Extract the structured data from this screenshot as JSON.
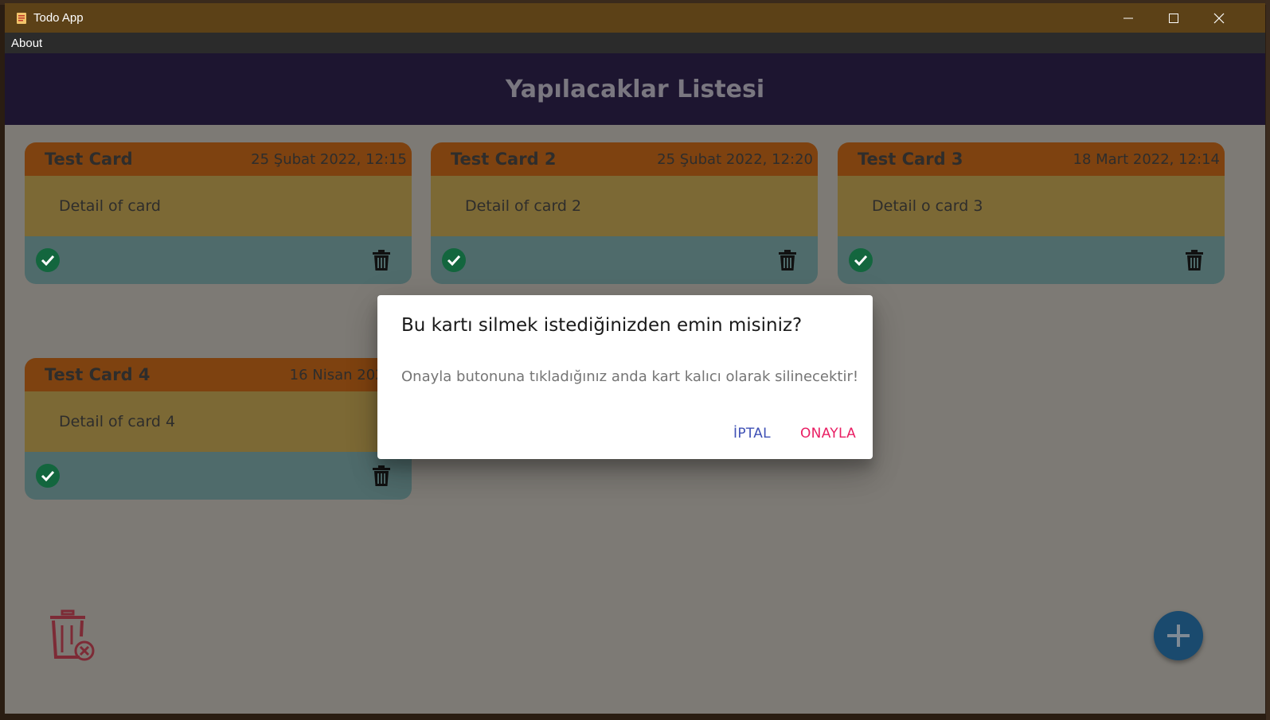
{
  "window": {
    "title": "Todo App",
    "menu": [
      "About"
    ]
  },
  "header": {
    "title": "Yapılacaklar Listesi"
  },
  "cards": [
    {
      "title": "Test Card",
      "date": "25 Şubat 2022, 12:15",
      "detail": "Detail of card"
    },
    {
      "title": "Test Card 2",
      "date": "25 Şubat 2022, 12:20",
      "detail": "Detail of card 2"
    },
    {
      "title": "Test Card 3",
      "date": "18 Mart 2022, 12:14",
      "detail": "Detail o card 3"
    },
    {
      "title": "Test Card 4",
      "date": "16 Nisan 2022, 0",
      "detail": "Detail of card 4"
    }
  ],
  "dialog": {
    "title": "Bu kartı silmek istediğinizden emin misiniz?",
    "text": "Onayla butonuna tıkladığınız anda kart kalıcı olarak silinecektir!",
    "cancel_label": "İPTAL",
    "confirm_label": "ONAYLA"
  },
  "icons": {
    "app": "todo-app-icon",
    "complete": "check-circle-icon",
    "delete": "trash-icon",
    "bulk_delete": "trash-x-icon",
    "add": "plus-icon"
  },
  "colors": {
    "titlebar": "#5c4117",
    "header": "#1d1530",
    "card_head": "#7e4210",
    "card_body": "#7c6935",
    "card_foot": "#4f6b6b",
    "cancel": "#3f51b5",
    "confirm": "#e91e63",
    "fab": "#1a4a6e"
  }
}
